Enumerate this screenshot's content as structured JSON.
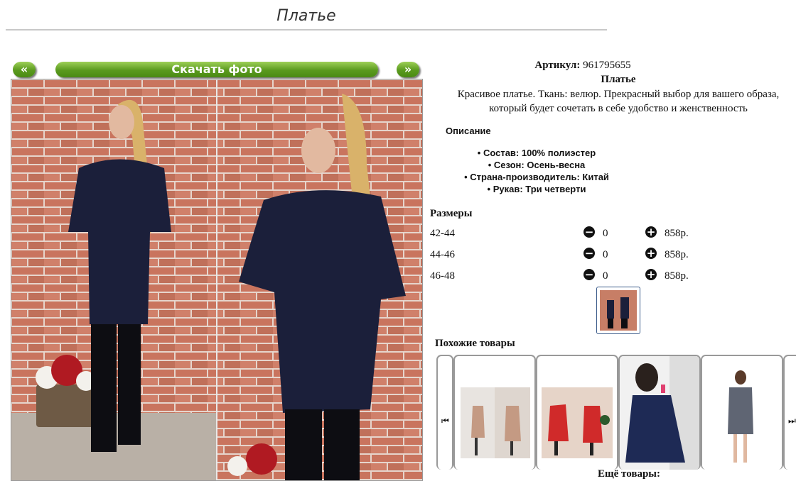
{
  "page": {
    "title": "Платье"
  },
  "gallery": {
    "prev_label": "«",
    "next_label": "»",
    "download_label": "Скачать фото"
  },
  "product": {
    "sku_label": "Артикул:",
    "sku_value": "961795655",
    "name": "Платье",
    "description": "Красивое платье. Ткань: велюр. Прекрасный выбор для вашего образа, который будет сочетать в себе удобство и женственность",
    "description_heading": "Описание",
    "specs": [
      "Состав: 100% полиэстер",
      "Сезон: Осень-весна",
      "Страна-производитель: Китай",
      "Рукав: Три четверти"
    ]
  },
  "sizes": {
    "heading": "Размеры",
    "rows": [
      {
        "size": "42-44",
        "qty": "0",
        "price": "858р."
      },
      {
        "size": "44-46",
        "qty": "0",
        "price": "858р."
      },
      {
        "size": "46-48",
        "qty": "0",
        "price": "858р."
      }
    ]
  },
  "similar": {
    "heading": "Похожие товары",
    "more_label": "Ещё товары:"
  },
  "colors": {
    "button_green": "#5a9a1e",
    "brick": "#c77e66",
    "dress_navy": "#1b1f3a",
    "hair_blond": "#d9b26a",
    "thumb_border": "#3b5b8a"
  },
  "icons": {
    "minus": "minus-circle-icon",
    "plus": "plus-circle-icon",
    "carousel_prev": "skip-prev-icon",
    "carousel_next": "skip-next-icon"
  }
}
